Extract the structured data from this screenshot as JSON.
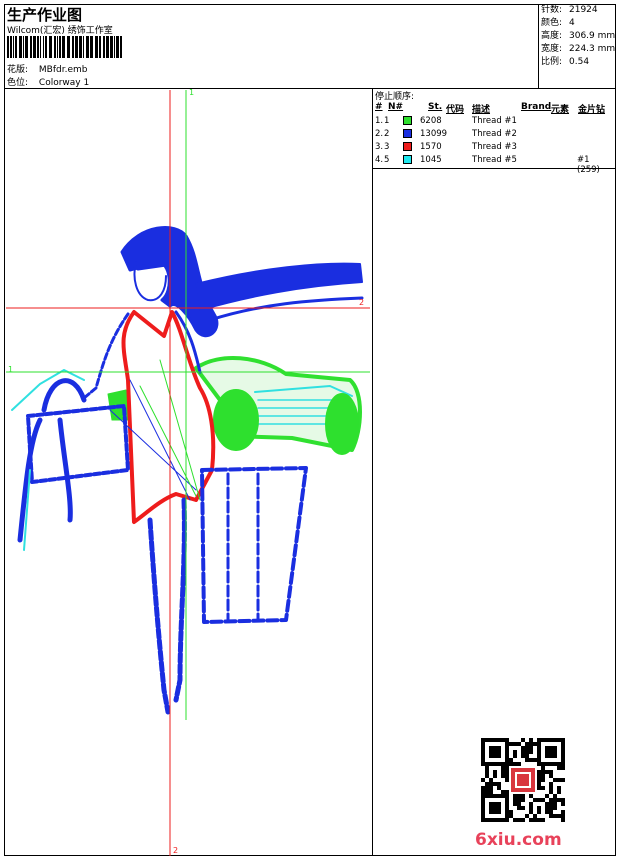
{
  "header": {
    "title": "生产作业图",
    "company": "Wilcom(汇宏) 绣饰工作室",
    "design_label": "花版:",
    "design_value": "MBfdr.emb",
    "colorway_label": "色位:",
    "colorway_value": "Colorway 1"
  },
  "stats": [
    {
      "label": "针数:",
      "value": "21924"
    },
    {
      "label": "颜色:",
      "value": "4"
    },
    {
      "label": "高度:",
      "value": "306.9 mm"
    },
    {
      "label": "宽度:",
      "value": "224.3 mm"
    },
    {
      "label": "比例:",
      "value": "0.54"
    }
  ],
  "stop_sequence": {
    "title": "停止顺序:",
    "columns": {
      "hash": "#",
      "n": "N#",
      "st": "St.",
      "code": "代码",
      "desc": "描述",
      "brand": "Brand",
      "element": "元素",
      "metallic": "金片钻"
    },
    "rows": [
      {
        "num": "1.",
        "n": "1",
        "color": "#2ee02e",
        "stitches": "6208",
        "desc": "Thread #1",
        "metallic": ""
      },
      {
        "num": "2.",
        "n": "2",
        "color": "#1a2ee0",
        "stitches": "13099",
        "desc": "Thread #2",
        "metallic": ""
      },
      {
        "num": "3.",
        "n": "3",
        "color": "#ee1c1c",
        "stitches": "1570",
        "desc": "Thread #3",
        "metallic": ""
      },
      {
        "num": "4.",
        "n": "5",
        "color": "#1ee8ee",
        "stitches": "1045",
        "desc": "Thread #5",
        "metallic": "#1 (259)"
      }
    ]
  },
  "guides": {
    "green_label": "1",
    "red_label": "2"
  },
  "watermark": "6xiu.com"
}
